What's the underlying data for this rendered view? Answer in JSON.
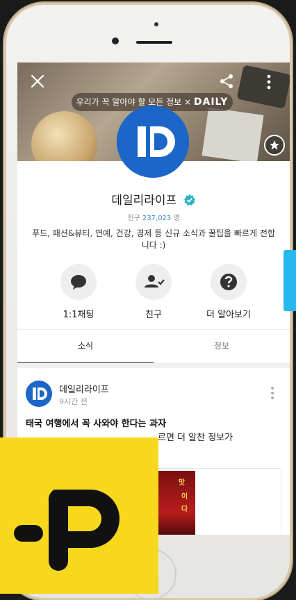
{
  "header": {
    "tagline_prefix": "우리가 꼭 알아야 할 모든 정보 ×",
    "tagline_brand": "DAILY"
  },
  "profile": {
    "name": "데일리라이프",
    "friends_label": "친구",
    "friends_count": "237,023",
    "friends_unit": "명",
    "description": "푸드, 패션&뷰티, 연예, 건강, 경제 등 신규 소식과 꿀팁을 빠르게 전합니다 :)"
  },
  "actions": [
    {
      "label": "1:1채팅",
      "icon": "chat-bubble-icon"
    },
    {
      "label": "친구",
      "icon": "person-check-icon"
    },
    {
      "label": "더 알아보기",
      "icon": "question-icon"
    }
  ],
  "tabs": [
    {
      "label": "소식",
      "active": true
    },
    {
      "label": "정보",
      "active": false
    }
  ],
  "post": {
    "author": "데일리라이프",
    "time": "9시간 전",
    "title": "태국 여행에서 꼭 사와야 한다는 과자",
    "body": "르면 더 알찬 정보가",
    "thumb_text_1": "맛",
    "thumb_text_2": "이",
    "thumb_text_3": "다"
  },
  "colors": {
    "brand_blue": "#1c66c9",
    "brand_yellow": "#f8d81c",
    "accent_cyan": "#27b8f0"
  }
}
